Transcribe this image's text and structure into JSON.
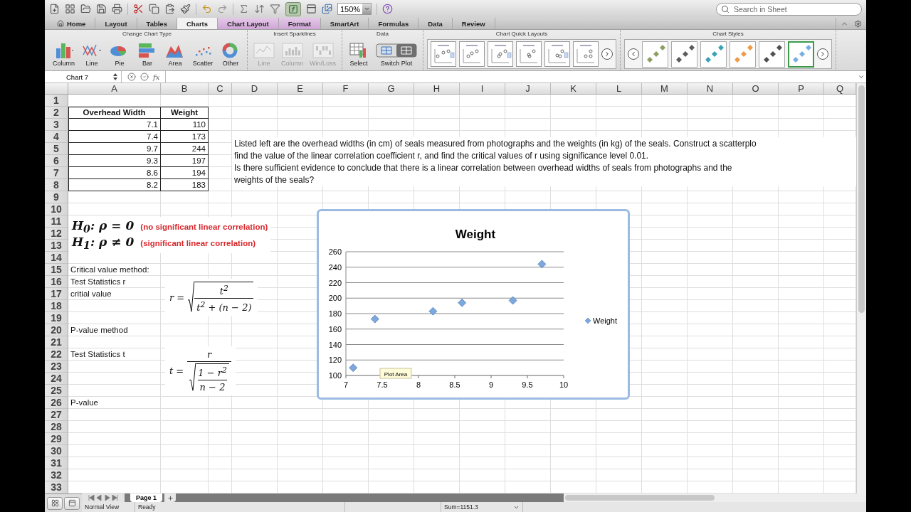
{
  "toolbar": {
    "zoom": "150%",
    "search": {
      "placeholder": "Search in Sheet"
    }
  },
  "tabs": [
    {
      "label": "Home",
      "kind": "home",
      "selected": false
    },
    {
      "label": "Layout",
      "kind": "standard",
      "selected": false
    },
    {
      "label": "Tables",
      "kind": "standard",
      "selected": false
    },
    {
      "label": "Charts",
      "kind": "standard",
      "selected": true
    },
    {
      "label": "Chart Layout",
      "kind": "contextual",
      "selected": false
    },
    {
      "label": "Format",
      "kind": "contextual",
      "selected": false
    },
    {
      "label": "SmartArt",
      "kind": "standard",
      "selected": false
    },
    {
      "label": "Formulas",
      "kind": "standard",
      "selected": false
    },
    {
      "label": "Data",
      "kind": "standard",
      "selected": false
    },
    {
      "label": "Review",
      "kind": "standard",
      "selected": false
    }
  ],
  "ribbon": {
    "change_chart_type": {
      "title": "Change Chart Type",
      "buttons": [
        {
          "label": "Column",
          "kind": "column",
          "disabled": false
        },
        {
          "label": "Line",
          "kind": "line",
          "disabled": false
        },
        {
          "label": "Pie",
          "kind": "pie",
          "disabled": false
        },
        {
          "label": "Bar",
          "kind": "bar",
          "disabled": false
        },
        {
          "label": "Area",
          "kind": "area",
          "disabled": false
        },
        {
          "label": "Scatter",
          "kind": "scatter",
          "disabled": false
        },
        {
          "label": "Other",
          "kind": "other",
          "disabled": false
        }
      ]
    },
    "insert_sparklines": {
      "title": "Insert Sparklines",
      "buttons": [
        {
          "label": "Line",
          "kind": "sparkline-line",
          "disabled": true
        },
        {
          "label": "Column",
          "kind": "sparkline-column",
          "disabled": true
        },
        {
          "label": "Win/Loss",
          "kind": "win-loss",
          "disabled": true
        }
      ]
    },
    "data": {
      "title": "Data",
      "buttons": [
        {
          "label": "Select",
          "kind": "select",
          "disabled": false
        },
        {
          "label": "Switch Plot",
          "kind": "switch-plot",
          "disabled": false
        }
      ]
    },
    "chart_quick_layouts": {
      "title": "Chart Quick Layouts"
    },
    "chart_styles": {
      "title": "Chart Styles",
      "styles": [
        {
          "color": "#8c9e62",
          "selected": false
        },
        {
          "color": "#5a5a5a",
          "selected": false
        },
        {
          "color": "#3aa3b5",
          "selected": false
        },
        {
          "color": "#ef9a45",
          "selected": false
        },
        {
          "color": "#505050",
          "selected": false
        },
        {
          "color": "#7aaee0",
          "selected": true
        }
      ]
    }
  },
  "formula_bar": {
    "name_box": "Chart 7",
    "function_label": "fx"
  },
  "sheet": {
    "columns": [
      "A",
      "B",
      "C",
      "D",
      "E",
      "F",
      "G",
      "H",
      "I",
      "J",
      "K",
      "L",
      "M",
      "N",
      "O",
      "P",
      "Q"
    ],
    "rows": [
      {
        "number": "1",
        "kind": "blank"
      },
      {
        "number": "2",
        "kind": "header",
        "a": "Overhead Width",
        "b": "Weight"
      },
      {
        "number": "3",
        "kind": "data",
        "a": "7.1",
        "b": "110"
      },
      {
        "number": "4",
        "kind": "data",
        "a": "7.4",
        "b": "173"
      },
      {
        "number": "5",
        "kind": "data",
        "a": "9.7",
        "b": "244"
      },
      {
        "number": "6",
        "kind": "data",
        "a": "9.3",
        "b": "197"
      },
      {
        "number": "7",
        "kind": "data",
        "a": "8.6",
        "b": "194"
      },
      {
        "number": "8",
        "kind": "data",
        "a": "8.2",
        "b": "183"
      },
      {
        "number": "9",
        "kind": "blank"
      },
      {
        "number": "10",
        "kind": "blank"
      },
      {
        "number": "11",
        "kind": "blank"
      },
      {
        "number": "12",
        "kind": "blank"
      },
      {
        "number": "13",
        "kind": "blank"
      },
      {
        "number": "14",
        "kind": "blank"
      },
      {
        "number": "15",
        "kind": "label",
        "a": "Critical value method:"
      },
      {
        "number": "16",
        "kind": "label",
        "a": "Test Statistics r"
      },
      {
        "number": "17",
        "kind": "label",
        "a": "critial value"
      },
      {
        "number": "18",
        "kind": "blank"
      },
      {
        "number": "19",
        "kind": "blank"
      },
      {
        "number": "20",
        "kind": "label",
        "a": "P-value method"
      },
      {
        "number": "21",
        "kind": "blank"
      },
      {
        "number": "22",
        "kind": "label",
        "a": "Test Statistics t"
      },
      {
        "number": "23",
        "kind": "blank"
      },
      {
        "number": "24",
        "kind": "blank"
      },
      {
        "number": "25",
        "kind": "blank"
      },
      {
        "number": "26",
        "kind": "label",
        "a": "P-value"
      },
      {
        "number": "27",
        "kind": "blank"
      },
      {
        "number": "28",
        "kind": "blank"
      },
      {
        "number": "29",
        "kind": "blank"
      },
      {
        "number": "30",
        "kind": "blank"
      },
      {
        "number": "31",
        "kind": "blank"
      },
      {
        "number": "32",
        "kind": "blank"
      },
      {
        "number": "33",
        "kind": "blank"
      }
    ]
  },
  "text_box": {
    "lines": [
      "Listed left are the overhead widths (in cm) of seals measured from photographs and the weights (in kg) of the seals. Construct a scatterplo",
      "find the value of the linear correlation coefficient r, and find the critical values of r using significance level 0.01.",
      "Is there sufficient evidence to conclude that there is a linear correlation between overhead widths of seals from photographs and the",
      "weights of the seals?"
    ]
  },
  "hypotheses": [
    {
      "label": "H$_{0}$: ρ = 0",
      "note": "(no significant linear correlation)"
    },
    {
      "label": "H$_{1}$: ρ ≠ 0",
      "note": "(significant linear correlation)"
    }
  ],
  "formulas": [
    {
      "kind": "r",
      "lhs": "r =",
      "numerator": "t$^{2}$",
      "denominator": "t$^{2}$ + (n − 2)"
    },
    {
      "kind": "t",
      "lhs": "t =",
      "numerator": "r",
      "inner_numerator": "1 − r$^{2}$",
      "inner_denominator": "n − 2"
    }
  ],
  "chart": {
    "tooltip": "Plot Area",
    "chart_data": {
      "type": "scatter",
      "title": "Weight",
      "x": [
        7.1,
        7.4,
        9.7,
        9.3,
        8.6,
        8.2
      ],
      "series": [
        {
          "name": "Weight",
          "color": "#7ea8da",
          "values": [
            110,
            173,
            244,
            197,
            194,
            183
          ]
        }
      ],
      "xlim": [
        7,
        10
      ],
      "ylim": [
        100,
        260
      ],
      "grid": true,
      "xticks": [
        7,
        7.5,
        8,
        8.5,
        9,
        9.5,
        10
      ],
      "yticks": [
        100,
        120,
        140,
        160,
        180,
        200,
        220,
        240,
        260
      ]
    }
  },
  "sheet_tabs": [
    {
      "label": "Page 1",
      "selected": true
    }
  ],
  "status_bar": {
    "view": "Normal View",
    "mode": "Ready",
    "sum": "Sum=1151.3"
  }
}
